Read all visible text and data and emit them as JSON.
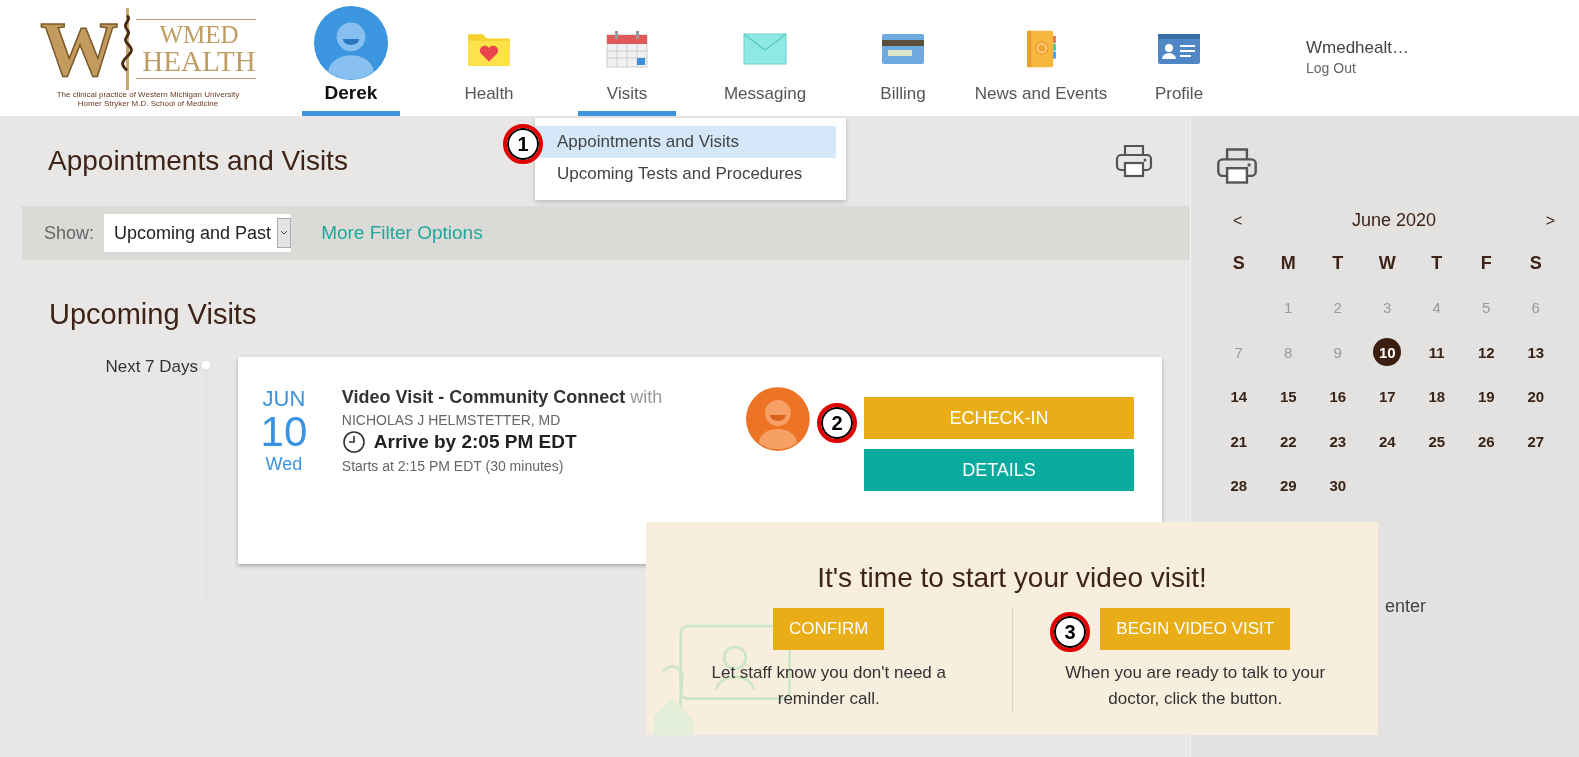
{
  "logo": {
    "letter": "W",
    "name_top": "WMED",
    "name_bottom": "HEALTH",
    "tagline_1": "The clinical practice of Western Michigan University",
    "tagline_2": "Homer Stryker M.D. School of Medicine"
  },
  "nav": [
    {
      "label": "Derek",
      "kind": "avatar",
      "selected": true
    },
    {
      "label": "Health",
      "kind": "icon",
      "selected": false
    },
    {
      "label": "Visits",
      "kind": "icon",
      "selected": true
    },
    {
      "label": "Messaging",
      "kind": "icon",
      "selected": false
    },
    {
      "label": "Billing",
      "kind": "icon",
      "selected": false
    },
    {
      "label": "News and Events",
      "kind": "icon",
      "selected": false
    },
    {
      "label": "Profile",
      "kind": "icon",
      "selected": false
    }
  ],
  "account": {
    "name": "Wmedhealt…",
    "logout": "Log Out"
  },
  "visits_menu": [
    {
      "label": "Appointments and Visits",
      "selected": true
    },
    {
      "label": "Upcoming Tests and Procedures",
      "selected": false
    }
  ],
  "page_title": "Appointments and Visits",
  "filter": {
    "label": "Show:",
    "value": "Upcoming and Past",
    "link": "More Filter Options"
  },
  "section_title": "Upcoming Visits",
  "timeline_label": "Next 7 Days",
  "visit": {
    "month": "JUN",
    "day": "10",
    "weekday": "Wed",
    "title": "**Video Visit - Community Connect** with",
    "provider": "NICHOLAS J HELMSTETTER, MD",
    "arrive": "Arrive by 2:05 PM EDT",
    "starts": "Starts at 2:15 PM EDT (30 minutes)",
    "buttons": [
      {
        "label": "ECHECK-IN",
        "color": "#e9ae17"
      },
      {
        "label": "DETAILS",
        "color": "#0aab9f"
      }
    ]
  },
  "calendar": {
    "prev": "<",
    "month": "June 2020",
    "next": ">",
    "weekdays": [
      "S",
      "M",
      "T",
      "W",
      "T",
      "F",
      "S"
    ],
    "weeks": [
      [
        {
          "day": "1",
          "disabled": true,
          "selected": false
        },
        {
          "day": "2",
          "disabled": true,
          "selected": false
        },
        {
          "day": "3",
          "disabled": true,
          "selected": false
        },
        {
          "day": "4",
          "disabled": true,
          "selected": false
        },
        {
          "day": "5",
          "disabled": true,
          "selected": false
        },
        {
          "day": "6",
          "disabled": true,
          "selected": false
        }
      ],
      [
        {
          "day": "7",
          "disabled": true,
          "selected": false
        },
        {
          "day": "8",
          "disabled": true,
          "selected": false
        },
        {
          "day": "9",
          "disabled": true,
          "selected": false
        },
        {
          "day": "10",
          "disabled": false,
          "selected": true
        },
        {
          "day": "11",
          "disabled": false,
          "selected": false
        },
        {
          "day": "12",
          "disabled": false,
          "selected": false
        },
        {
          "day": "13",
          "disabled": false,
          "selected": false
        }
      ],
      [
        {
          "day": "14",
          "disabled": false,
          "selected": false
        },
        {
          "day": "15",
          "disabled": false,
          "selected": false
        },
        {
          "day": "16",
          "disabled": false,
          "selected": false
        },
        {
          "day": "17",
          "disabled": false,
          "selected": false
        },
        {
          "day": "18",
          "disabled": false,
          "selected": false
        },
        {
          "day": "19",
          "disabled": false,
          "selected": false
        },
        {
          "day": "20",
          "disabled": false,
          "selected": false
        }
      ],
      [
        {
          "day": "21",
          "disabled": false,
          "selected": false
        },
        {
          "day": "22",
          "disabled": false,
          "selected": false
        },
        {
          "day": "23",
          "disabled": false,
          "selected": false
        },
        {
          "day": "24",
          "disabled": false,
          "selected": false
        },
        {
          "day": "25",
          "disabled": false,
          "selected": false
        },
        {
          "day": "26",
          "disabled": false,
          "selected": false
        },
        {
          "day": "27",
          "disabled": false,
          "selected": false
        }
      ],
      [
        {
          "day": "28",
          "disabled": false,
          "selected": false
        },
        {
          "day": "29",
          "disabled": false,
          "selected": false
        },
        {
          "day": "30",
          "disabled": false,
          "selected": false
        }
      ]
    ],
    "footer_text": "enter"
  },
  "popup": {
    "title": "It's time to start your video visit!",
    "options": [
      {
        "button": "CONFIRM",
        "text": "Let staff know you don't need a reminder call."
      },
      {
        "button": "BEGIN VIDEO VISIT",
        "text": "When you are ready to talk to your doctor, click the button."
      }
    ]
  },
  "callouts": [
    "1",
    "2",
    "3"
  ]
}
